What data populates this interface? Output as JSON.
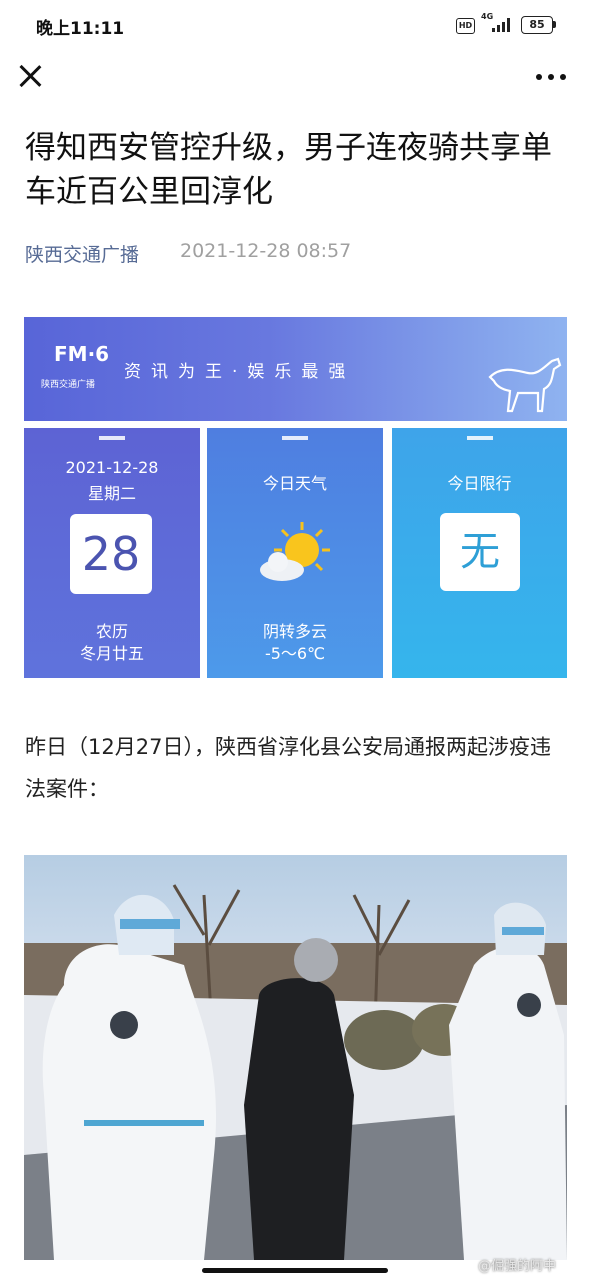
{
  "status_bar": {
    "time": "晚上11:11",
    "hd_label": "HD",
    "network": "4G",
    "battery": "85"
  },
  "nav": {
    "close_icon": "close-icon",
    "more_icon": "more-icon"
  },
  "article": {
    "title": "得知西安管控升级，男子连夜骑共享单车近百公里回淳化",
    "author": "陕西交通广播",
    "date": "2021-12-28 08:57",
    "paragraph": "昨日（12月27日），陕西省淳化县公安局通报两起涉疫违法案件："
  },
  "banner": {
    "logo_mark": "FM·6",
    "logo_name": "陕西交通广播",
    "slogan": "资讯为王·娱乐最强"
  },
  "cards": {
    "date": {
      "date": "2021-12-28",
      "weekday": "星期二",
      "day": "28",
      "lunar_label": "农历",
      "lunar_date": "冬月廿五"
    },
    "weather": {
      "label": "今日天气",
      "condition": "阴转多云",
      "temperature": "-5～6℃"
    },
    "limit": {
      "label": "今日限行",
      "value": "无"
    }
  },
  "watermark": "@倔强的阿中"
}
